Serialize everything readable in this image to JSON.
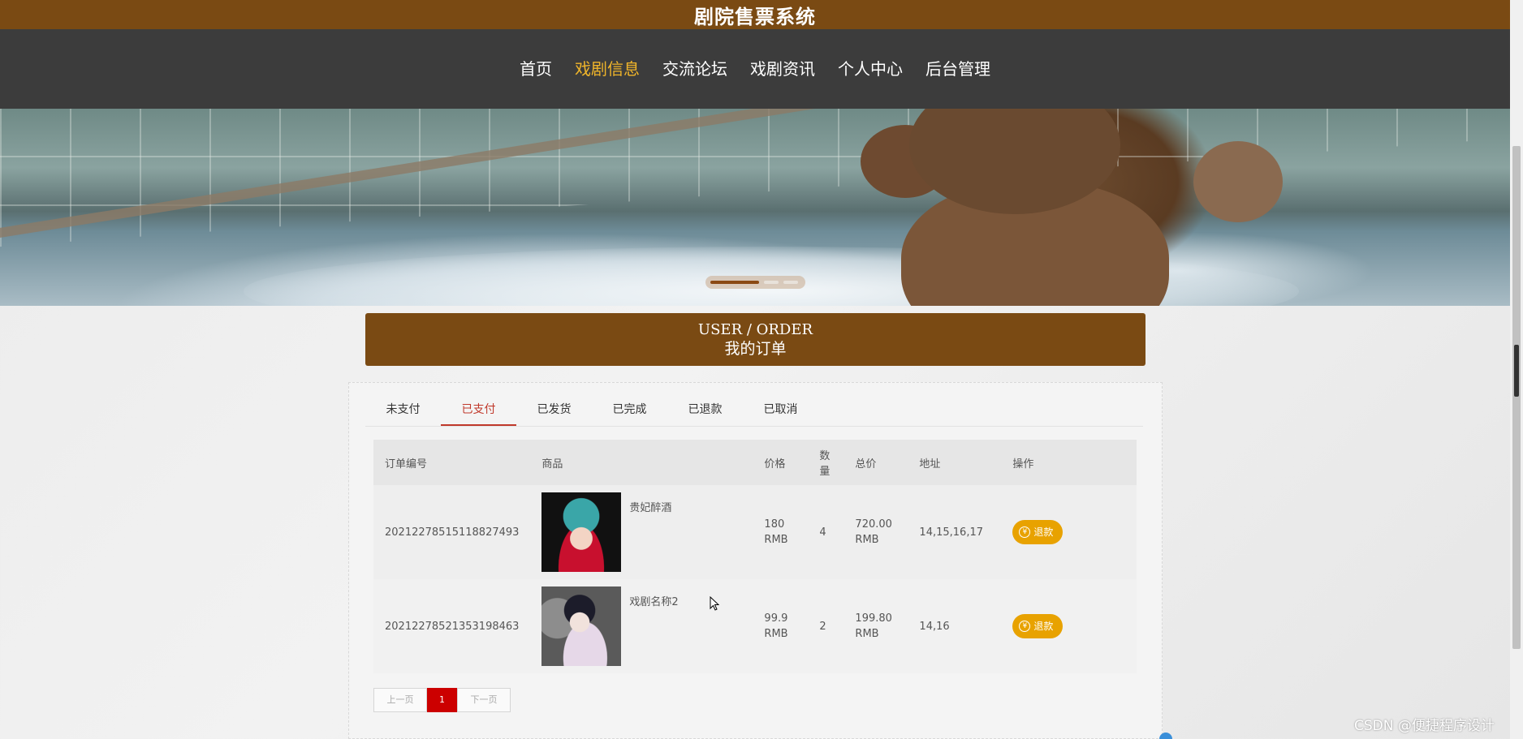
{
  "header": {
    "site_title": "剧院售票系统"
  },
  "nav": {
    "items": [
      {
        "label": "首页",
        "active": false
      },
      {
        "label": "戏剧信息",
        "active": true
      },
      {
        "label": "交流论坛",
        "active": false
      },
      {
        "label": "戏剧资讯",
        "active": false
      },
      {
        "label": "个人中心",
        "active": false
      },
      {
        "label": "后台管理",
        "active": false
      }
    ]
  },
  "section": {
    "title_en": "USER / ORDER",
    "title_cn": "我的订单"
  },
  "tabs": [
    {
      "label": "未支付",
      "active": false
    },
    {
      "label": "已支付",
      "active": true
    },
    {
      "label": "已发货",
      "active": false
    },
    {
      "label": "已完成",
      "active": false
    },
    {
      "label": "已退款",
      "active": false
    },
    {
      "label": "已取消",
      "active": false
    }
  ],
  "table": {
    "headers": {
      "order_id": "订单编号",
      "goods": "商品",
      "price": "价格",
      "qty_line1": "数",
      "qty_line2": "量",
      "total": "总价",
      "address": "地址",
      "action": "操作"
    },
    "rows": [
      {
        "order_id": "20212278515118827493",
        "goods_name": "贵妃醉酒",
        "price_value": "180",
        "price_unit": "RMB",
        "qty": "4",
        "total_value": "720.00",
        "total_unit": "RMB",
        "address": "14,15,16,17",
        "action": "退款"
      },
      {
        "order_id": "20212278521353198463",
        "goods_name": "戏剧名称2",
        "price_value": "99.9",
        "price_unit": "RMB",
        "qty": "2",
        "total_value": "199.80",
        "total_unit": "RMB",
        "address": "14,16",
        "action": "退款"
      }
    ]
  },
  "pager": {
    "prev": "上一页",
    "current": "1",
    "next": "下一页"
  },
  "watermark": "CSDN @便捷程序设计",
  "icons": {
    "refund": "yen-icon"
  },
  "colors": {
    "brand_brown": "#7a4a13",
    "nav_bg": "#3c3c3c",
    "active_nav": "#f0b52a",
    "active_tab": "#c0392b",
    "refund_btn": "#e8a200",
    "pager_current": "#cc0000"
  }
}
